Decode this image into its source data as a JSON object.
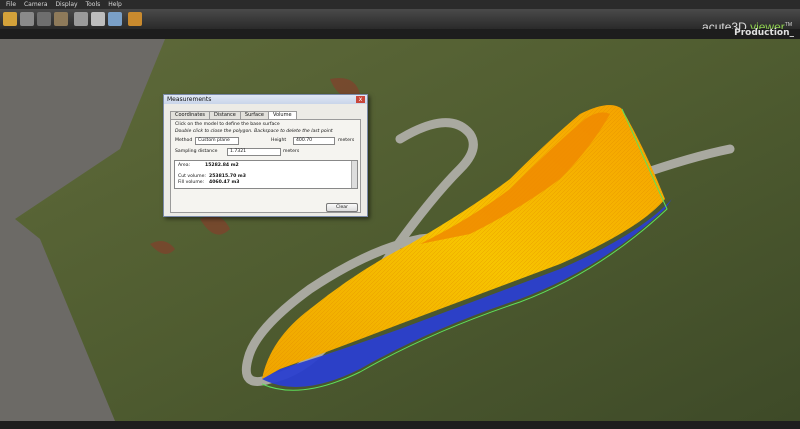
{
  "menu": [
    "File",
    "Camera",
    "Display",
    "Tools",
    "Help"
  ],
  "brand": {
    "name": "acute3D ",
    "accent": "viewer",
    "tm": "TM"
  },
  "subtitle": "Production_",
  "status": {
    "left": ""
  },
  "dialog": {
    "title": "Measurements",
    "close_glyph": "x",
    "tabs": [
      "Coordinates",
      "Distance",
      "Surface",
      "Volume"
    ],
    "active_tab": "Volume",
    "instr1": "Click on the model to define the base surface",
    "instr2": "Double click to close the polygon. Backspace to delete the last point",
    "method_label": "Method",
    "method_value": "Custom plane",
    "height_label": "Height",
    "height_value": "400.70",
    "height_unit": "meters",
    "sampling_label": "Sampling distance",
    "sampling_value": "1.7321",
    "sampling_unit": "meters",
    "area_label": "Area:",
    "area_value": "15282.84 m2",
    "cut_label": "Cut volume:",
    "cut_value": "253815.70 m3",
    "fill_label": "Fill volume:",
    "fill_value": "4060.47 m3",
    "clear_button": "Clear"
  },
  "colors": {
    "toolbar": "#2e2e2e",
    "cut": "#f5b800",
    "fill": "#2a3fd0",
    "edge": "#f07a00"
  }
}
